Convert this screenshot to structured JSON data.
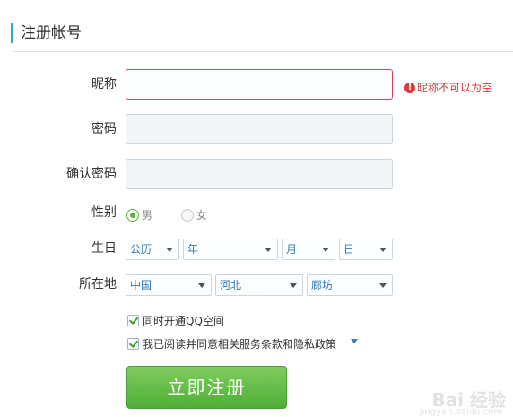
{
  "header": {
    "title": "注册帐号"
  },
  "form": {
    "nickname": {
      "label": "昵称",
      "value": "",
      "error": "昵称不可以为空"
    },
    "password": {
      "label": "密码",
      "value": ""
    },
    "confirm_password": {
      "label": "确认密码",
      "value": ""
    },
    "gender": {
      "label": "性别",
      "options": [
        "男",
        "女"
      ],
      "selected": "男"
    },
    "birthday": {
      "label": "生日",
      "calendar": "公历",
      "year": "年",
      "month": "月",
      "day": "日"
    },
    "location": {
      "label": "所在地",
      "country": "中国",
      "province": "河北",
      "city": "廊坊"
    },
    "checks": {
      "qq_space": {
        "label": "同时开通QQ空间",
        "checked": true
      },
      "agree": {
        "label": "我已阅读并同意相关服务条款和隐私政策",
        "checked": true
      }
    },
    "submit_label": "立即注册"
  },
  "watermark": {
    "text": "Bai 经验",
    "sub": "jingyan.baidu.com"
  },
  "colors": {
    "accent": "#3aa0d8",
    "error": "#d2415e",
    "success": "#4fad37",
    "link": "#2f79b5"
  }
}
